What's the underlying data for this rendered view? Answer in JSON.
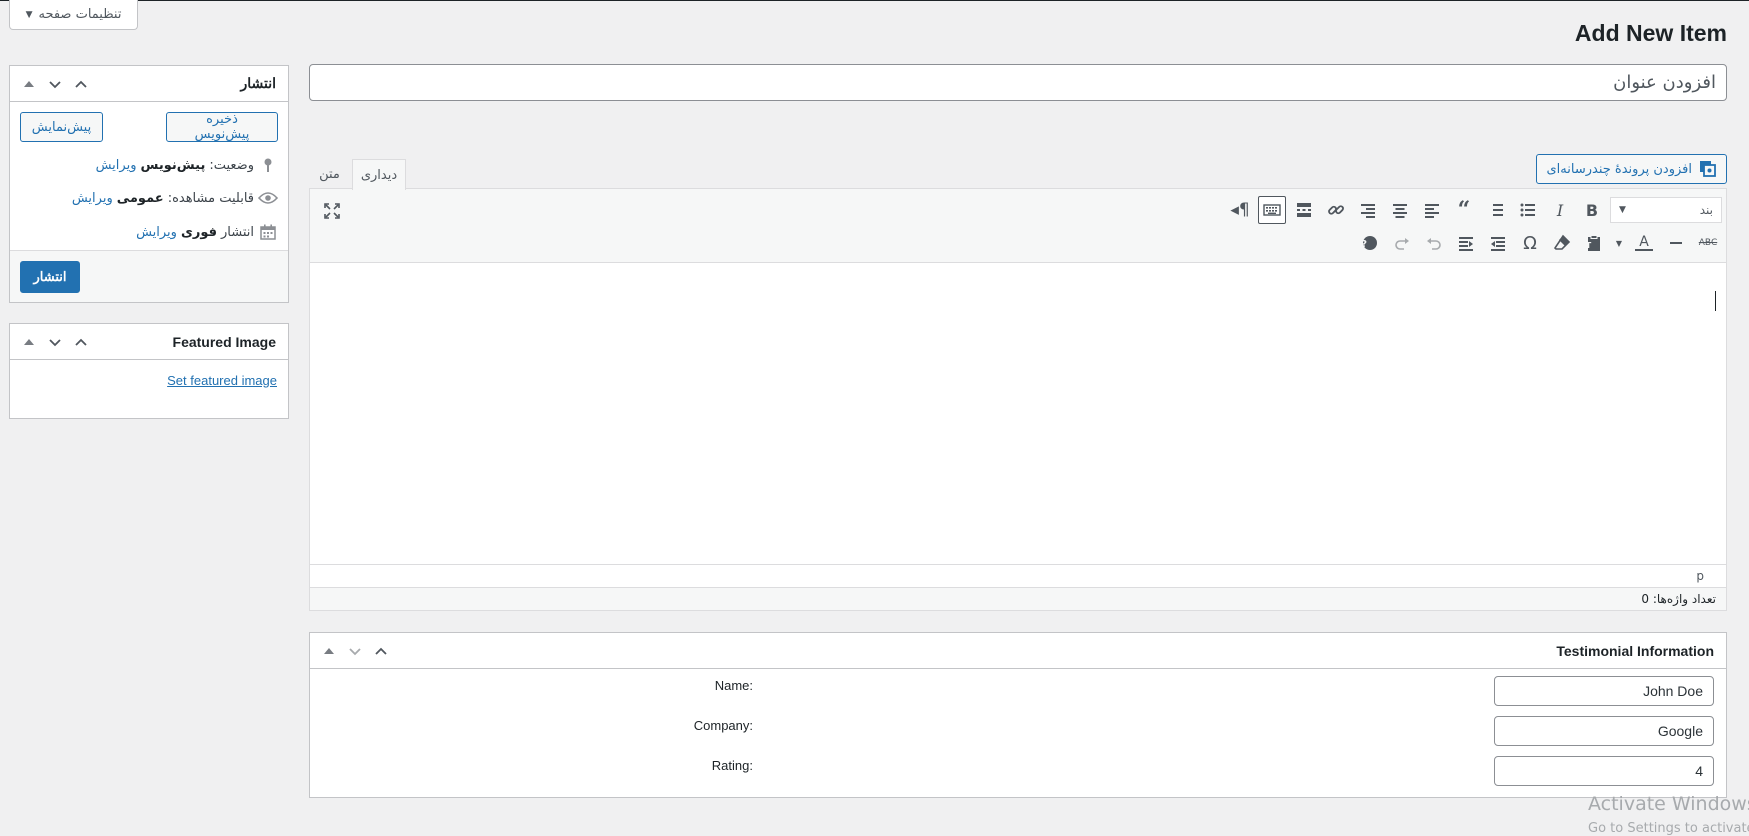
{
  "screen_options": {
    "label": "تنظیمات صفحه"
  },
  "page": {
    "title": "Add New Item"
  },
  "title_field": {
    "placeholder": "افزودن عنوان"
  },
  "publish_box": {
    "title": "انتشار",
    "save_draft": "ذخیره پیش‌نویس",
    "preview": "پیش‌نمایش",
    "status_label": "وضعیت:",
    "status_value": "پیش‌نویس",
    "visibility_label": "قابلیت مشاهده:",
    "visibility_value": "عمومی",
    "publish_label": "انتشار",
    "publish_value": "فوری",
    "edit": "ویرایش",
    "publish_button": "انتشار"
  },
  "featured_box": {
    "title": "Featured Image",
    "link": "Set featured image"
  },
  "media": {
    "add_label": "افزودن پروندهٔ چندرسانه‌ای"
  },
  "editor": {
    "tab_visual": "دیداری",
    "tab_text": "متن",
    "format_select": "بند",
    "path": "p",
    "word_count": "تعداد واژه‌ها: 0",
    "toolbar_row1": [
      "bold-icon",
      "italic-icon",
      "bullet-list-icon",
      "numbered-list-icon",
      "blockquote-icon",
      "align-left-icon",
      "align-center-icon",
      "align-right-icon",
      "link-icon",
      "read-more-icon",
      "toolbar-toggle-icon",
      "rtl-paragraph-icon"
    ],
    "toolbar_row2": [
      "strikethrough-icon",
      "horizontal-line-icon",
      "text-color-icon",
      "paste-text-icon",
      "clear-formatting-icon",
      "special-character-icon",
      "decrease-indent-icon",
      "increase-indent-icon",
      "undo-icon",
      "redo-icon",
      "help-icon"
    ]
  },
  "testimonial": {
    "title": "Testimonial Information",
    "fields": [
      {
        "label": "Name:",
        "value": "John Doe"
      },
      {
        "label": "Company:",
        "value": "Google"
      },
      {
        "label": "Rating:",
        "value": "4"
      }
    ]
  },
  "watermark": {
    "line1": "Activate Windows",
    "line2": "Go to Settings to activate Windows."
  },
  "colors": {
    "accent": "#2271b1",
    "background": "#f0f0f1",
    "border": "#c3c4c7"
  }
}
